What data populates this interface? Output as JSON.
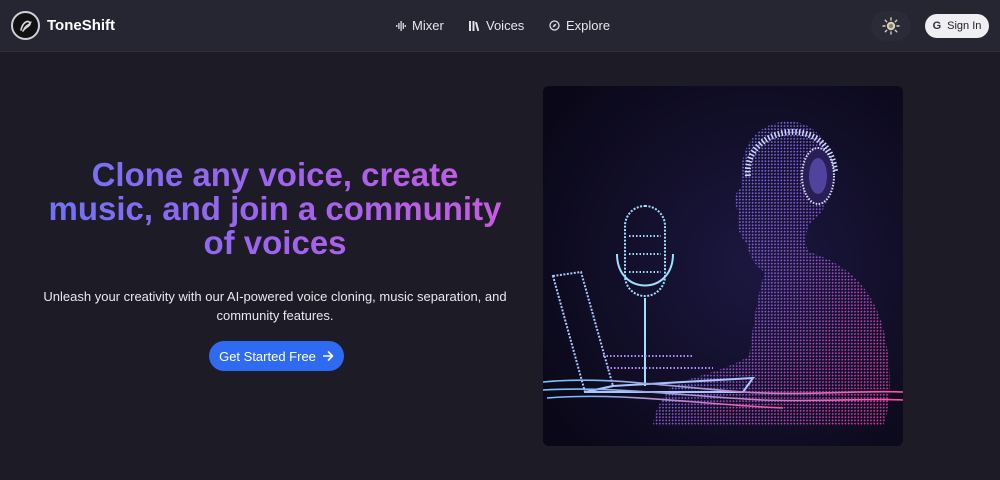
{
  "app": {
    "name": "ToneShift"
  },
  "nav": {
    "items": [
      {
        "label": "Mixer",
        "icon": "waveform-icon"
      },
      {
        "label": "Voices",
        "icon": "bars-icon"
      },
      {
        "label": "Explore",
        "icon": "compass-icon"
      }
    ]
  },
  "header": {
    "theme_icon": "sun-icon",
    "signin_icon": "google-icon",
    "signin_label": "Sign In"
  },
  "hero": {
    "headline": "Clone any voice, create music, and join a community of voices",
    "subtext": "Unleash your creativity with our AI-powered voice cloning, music separation, and community features.",
    "cta_label": "Get Started Free",
    "cta_icon": "arrow-right-icon",
    "image": "person-with-headphones-microphone-laptop-illustration"
  },
  "colors": {
    "background": "#1c1b26",
    "topbar": "#262633",
    "accent_blue": "#2f6bf2",
    "gradient_start": "#6f73f5",
    "gradient_end": "#c85bdf"
  }
}
